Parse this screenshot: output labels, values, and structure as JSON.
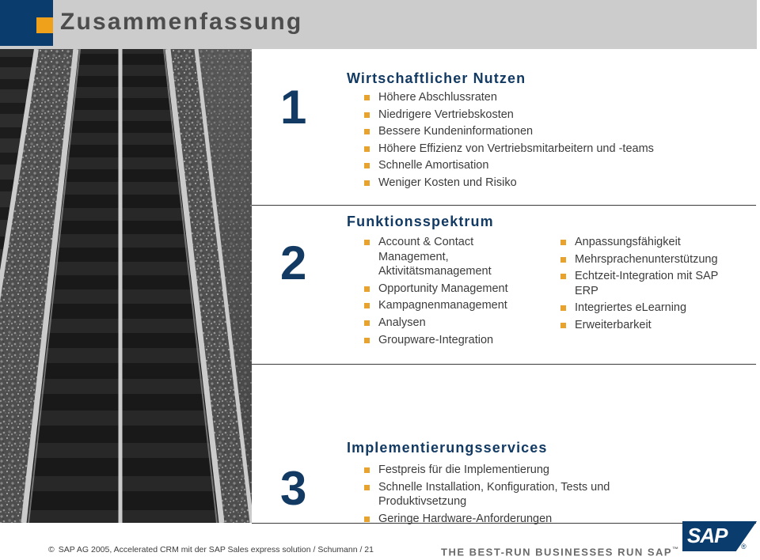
{
  "header": {
    "title": "Zusammenfassung",
    "blue_color": "#0a3d6e",
    "orange_color": "#f0a11b",
    "band_color": "#cccccc",
    "title_color": "#4d4d4d"
  },
  "photo": {
    "description": "railroad-tracks-black-and-white"
  },
  "sections": [
    {
      "number": "1",
      "heading": "Wirtschaftlicher Nutzen",
      "columns": [
        {
          "items": [
            "Höhere Abschlussraten",
            "Niedrigere Vertriebskosten",
            "Bessere Kundeninformationen",
            "Höhere Effizienz von Vertriebsmitarbeitern und -teams",
            "Schnelle Amortisation",
            "Weniger Kosten und Risiko"
          ]
        }
      ]
    },
    {
      "number": "2",
      "heading": "Funktionsspektrum",
      "columns": [
        {
          "items": [
            "Account & Contact Management, Aktivitätsmanagement",
            "Opportunity Management",
            "Kampagnenmanagement",
            "Analysen",
            "Groupware-Integration"
          ]
        },
        {
          "items": [
            "Anpassungsfähigkeit",
            "Mehrsprachenunterstützung",
            "Echtzeit-Integration mit SAP ERP",
            "Integriertes eLearning",
            "Erweiterbarkeit"
          ]
        }
      ]
    },
    {
      "number": "3",
      "heading": "Implementierungsservices",
      "columns": [
        {
          "items": [
            "Festpreis für die Implementierung",
            "Schnelle Installation, Konfiguration, Tests und Produktivsetzung",
            "Geringe Hardware-Anforderungen"
          ]
        }
      ]
    }
  ],
  "footer": {
    "copyright_mark": "©",
    "copyright": "SAP AG 2005, Accelerated CRM mit der SAP Sales express solution / Schumann / 21",
    "tagline": "THE BEST-RUN BUSINESSES RUN SAP",
    "tagline_tm": "™",
    "logo_text": "SAP",
    "logo_registered": "®"
  },
  "colors": {
    "accent_blue": "#123a63",
    "accent_orange": "#e8a22e",
    "body_text": "#3c3c3c"
  }
}
